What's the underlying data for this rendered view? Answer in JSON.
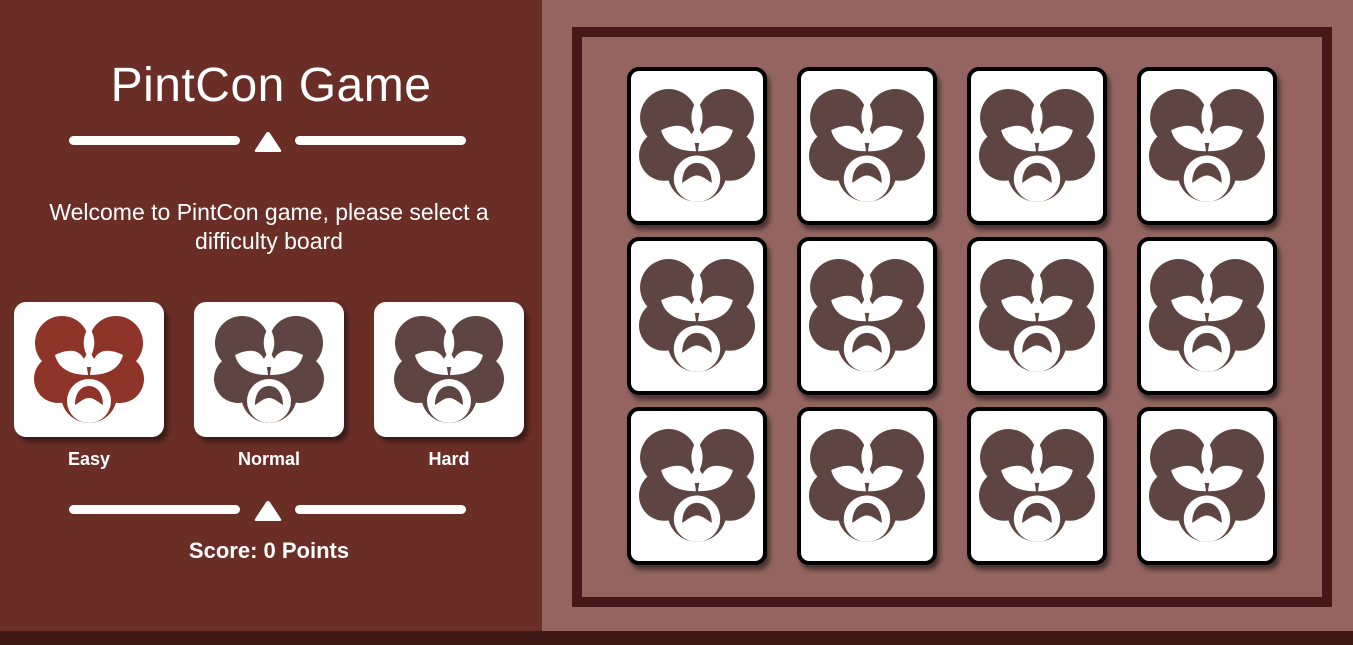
{
  "sidebar": {
    "title": "PintCon Game",
    "welcome": "Welcome to PintCon game, please select a difficulty board",
    "difficulties": [
      {
        "label": "Easy",
        "selected": true
      },
      {
        "label": "Normal",
        "selected": false
      },
      {
        "label": "Hard",
        "selected": false
      }
    ],
    "score": "Score: 0 Points"
  },
  "board": {
    "rows": 3,
    "columns": 4,
    "cards": [
      {
        "state": "face-down",
        "icon": "pintcon-logo-icon"
      },
      {
        "state": "face-down",
        "icon": "pintcon-logo-icon"
      },
      {
        "state": "face-down",
        "icon": "pintcon-logo-icon"
      },
      {
        "state": "face-down",
        "icon": "pintcon-logo-icon"
      },
      {
        "state": "face-down",
        "icon": "pintcon-logo-icon"
      },
      {
        "state": "face-down",
        "icon": "pintcon-logo-icon"
      },
      {
        "state": "face-down",
        "icon": "pintcon-logo-icon"
      },
      {
        "state": "face-down",
        "icon": "pintcon-logo-icon"
      },
      {
        "state": "face-down",
        "icon": "pintcon-logo-icon"
      },
      {
        "state": "face-down",
        "icon": "pintcon-logo-icon"
      },
      {
        "state": "face-down",
        "icon": "pintcon-logo-icon"
      },
      {
        "state": "face-down",
        "icon": "pintcon-logo-icon"
      }
    ]
  },
  "colors": {
    "sidebar_bg": "#6a2e27",
    "board_bg": "#946560",
    "board_frame": "#45181a",
    "logo_default": "#5e4541",
    "logo_selected": "#8f3429"
  }
}
